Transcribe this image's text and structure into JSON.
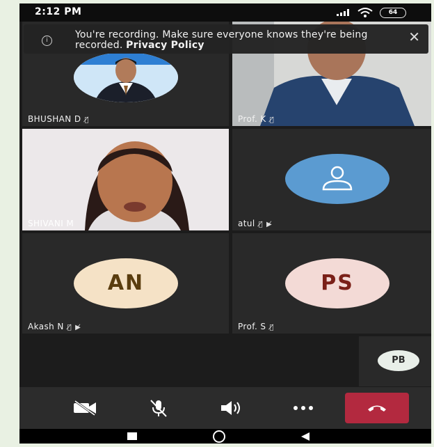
{
  "status": {
    "time": "2:12 PM",
    "battery": "64"
  },
  "banner": {
    "message": "You're recording. Make sure everyone knows they're being recorded.",
    "link": "Privacy Policy",
    "close": "✕"
  },
  "participants": [
    {
      "name": "BHUSHAN D",
      "muted": true,
      "kind": "photo-avatar"
    },
    {
      "name": "Prof. K",
      "muted": true,
      "kind": "video"
    },
    {
      "name": "SHIVANI M",
      "muted": false,
      "kind": "video"
    },
    {
      "name": "atul",
      "muted": true,
      "camera_off": true,
      "kind": "generic-avatar"
    },
    {
      "name": "Akash N",
      "muted": true,
      "camera_off": true,
      "kind": "initials",
      "initials": "AN",
      "bg": "#f5e2c6",
      "fg": "#5a3d0f"
    },
    {
      "name": "Prof. S",
      "muted": true,
      "kind": "initials",
      "initials": "PS",
      "bg": "#f3dad6",
      "fg": "#7a2018"
    }
  ],
  "overflow_participant": {
    "initials": "PB"
  },
  "controls": [
    "camera-off",
    "mic-off",
    "speaker",
    "more",
    "end-call"
  ],
  "colors": {
    "end_call": "#b3293f",
    "tile_bg": "#292929",
    "avatar_blue": "#5b9bd1"
  }
}
